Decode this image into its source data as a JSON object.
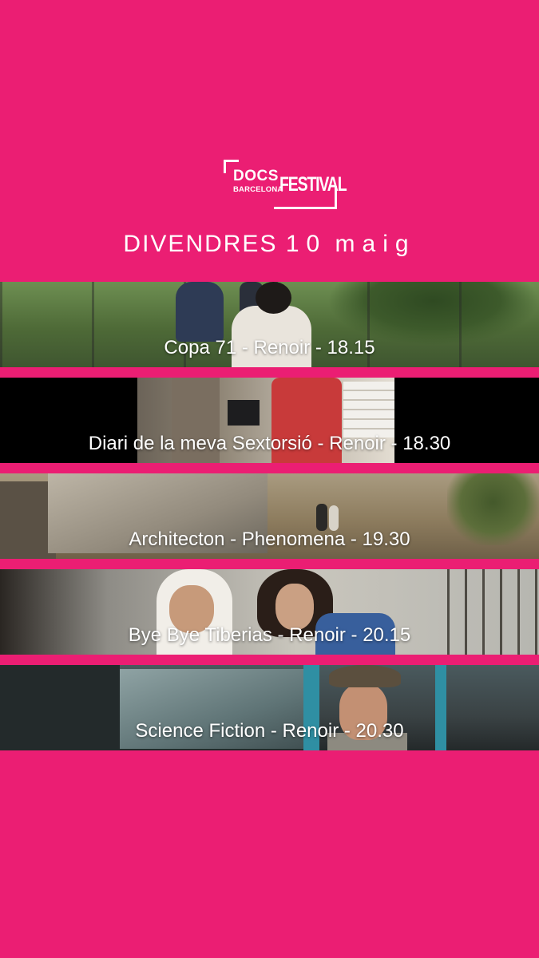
{
  "logo": {
    "docs": "DOCS",
    "barcelona": "BARCELONA",
    "festival": "FESTIVAL"
  },
  "date": {
    "weekday": "DIVENDRES",
    "day": "10",
    "month": "maig"
  },
  "screenings": [
    {
      "label": "Copa 71 - Renoir - 18.15"
    },
    {
      "label": "Diari de la meva Sextorsió - Renoir - 18.30"
    },
    {
      "label": "Architecton - Phenomena - 19.30"
    },
    {
      "label": "Bye Bye Tiberias - Renoir - 20.15"
    },
    {
      "label": "Science Fiction - Renoir - 20.30"
    }
  ],
  "colors": {
    "background": "#EB1E73",
    "text": "#FFFFFF"
  }
}
